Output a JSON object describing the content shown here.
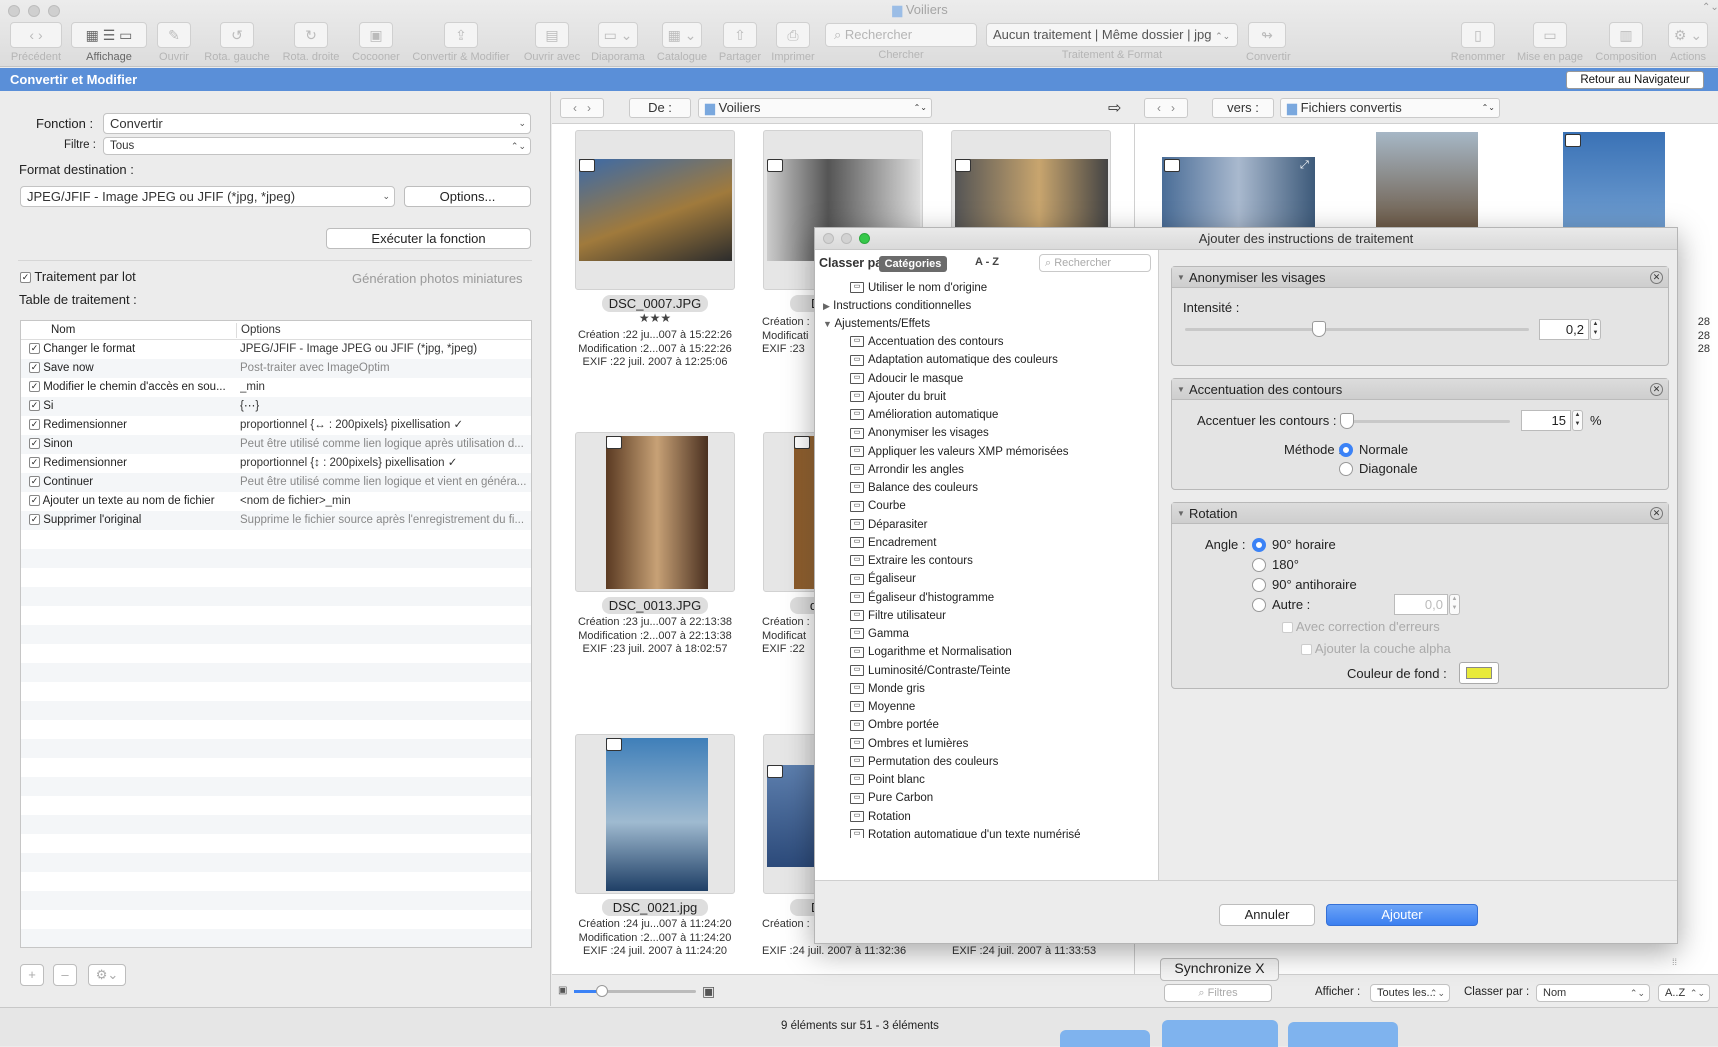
{
  "window": {
    "title": "Voiliers"
  },
  "toolbar": {
    "items": [
      "Précédent",
      "Affichage",
      "Ouvrir",
      "Rota. gauche",
      "Rota. droite",
      "Cocooner",
      "Convertir & Modifier",
      "Ouvrir avec",
      "Diaporama",
      "Catalogue",
      "Partager",
      "Imprimer"
    ],
    "search_placeholder": "Rechercher",
    "search_label": "Chercher",
    "treatment_value": "Aucun traitement | Même dossier | jpg",
    "treatment_label": "Traitement & Format",
    "convert_label": "Convertir",
    "right_items": [
      "Renommer",
      "Mise en page",
      "Composition",
      "Actions"
    ]
  },
  "convert_bar": {
    "title": "Convertir et Modifier",
    "back_button": "Retour au Navigateur"
  },
  "left": {
    "fonction_label": "Fonction :",
    "fonction_value": "Convertir",
    "filtre_label": "Filtre :",
    "filtre_value": "Tous",
    "format_label": "Format destination :",
    "format_value": "JPEG/JFIF - Image JPEG ou JFIF (*jpg, *jpeg)",
    "options_button": "Options...",
    "execute_button": "Exécuter la fonction",
    "batch_label": "Traitement par lot",
    "thumbs_link": "Génération photos miniatures",
    "table_label": "Table de traitement :",
    "table_headers": [
      "Nom",
      "Options"
    ],
    "rows": [
      {
        "name": "Changer le format",
        "options": "JPEG/JFIF - Image JPEG ou JFIF (*jpg, *jpeg)",
        "grey": false
      },
      {
        "name": "Save now",
        "options": "Post-traiter avec ImageOptim",
        "grey": true
      },
      {
        "name": "Modifier le chemin d'accès en sou...",
        "options": "_min",
        "grey": false
      },
      {
        "name": "Si",
        "options": "{⋯}",
        "grey": false
      },
      {
        "name": "Redimensionner",
        "options": "proportionnel {↔ : 200pixels}   pixellisation ✓",
        "grey": false
      },
      {
        "name": "Sinon",
        "options": "Peut être utilisé comme lien logique après utilisation d...",
        "grey": true
      },
      {
        "name": "Redimensionner",
        "options": "proportionnel {↕ : 200pixels}   pixellisation ✓",
        "grey": false
      },
      {
        "name": "Continuer",
        "options": "Peut être utilisé comme lien logique et vient en généra...",
        "grey": true
      },
      {
        "name": "Ajouter un texte au nom de fichier",
        "options": "<nom de fichier>_min",
        "grey": false
      },
      {
        "name": "Supprimer l'original",
        "options": "Supprime le fichier source après l'enregistrement du fi...",
        "grey": true
      }
    ]
  },
  "source_nav": {
    "de_label": "De :",
    "folder": "Voiliers"
  },
  "dest_nav": {
    "vers_label": "vers :",
    "folder": "Fichiers convertis"
  },
  "thumbs": [
    {
      "name": "DSC_0007.JPG",
      "stars": "★★★",
      "creation": "Création :22 ju...007 à 15:22:26",
      "modification": "Modification :2...007 à 15:22:26",
      "exif": "EXIF :22 juil. 2007 à 12:25:06"
    },
    {
      "name": "DSC_0013.JPG",
      "stars": "",
      "creation": "Création :23 ju...007 à 22:13:38",
      "modification": "Modification :2...007 à 22:13:38",
      "exif": "EXIF :23 juil. 2007 à 18:02:57"
    },
    {
      "name": "DSC_0021.jpg",
      "stars": "",
      "creation": "Création :24 ju...007 à 11:24:20",
      "modification": "Modification :2...007 à 11:24:20",
      "exif": "EXIF :24 juil. 2007 à 11:24:20"
    }
  ],
  "partial_thumbs": {
    "col2_name_1": "DS",
    "col2_creation_1": "Création :",
    "col2_modif_1": "Modificati",
    "col2_exif_1": "EXIF :23",
    "col2_name_2": "dsc",
    "col2_creation_2": "Création :",
    "col2_modif_2": "Modificat",
    "col2_exif_2": "EXIF :22",
    "col2_name_3": "DS",
    "col2_creation_3": "Création :",
    "col2_exif_3": "EXIF :24 juil. 2007 à 11:32:36",
    "col3_exif_3": "EXIF :24 juil. 2007 à 11:33:53",
    "right_edge_1": "28",
    "right_edge_2": "28",
    "right_edge_3": "28"
  },
  "dialog": {
    "title": "Ajouter des instructions de traitement",
    "sort_label": "Classer pa",
    "tab_categories": "Catégories",
    "tab_az": "A - Z",
    "search_placeholder": "Rechercher",
    "list_top": [
      "Utiliser le nom d'origine",
      "Instructions conditionnelles",
      "Ajustements/Effets"
    ],
    "effects": [
      "Accentuation des contours",
      "Adaptation automatique des couleurs",
      "Adoucir le masque",
      "Ajouter du bruit",
      "Amélioration automatique",
      "Anonymiser les visages",
      "Appliquer les valeurs XMP mémorisées",
      "Arrondir les angles",
      "Balance des couleurs",
      "Courbe",
      "Déparasiter",
      "Encadrement",
      "Extraire les contours",
      "Égaliseur",
      "Égaliseur d'histogramme",
      "Filtre utilisateur",
      "Gamma",
      "Logarithme et Normalisation",
      "Luminosité/Contraste/Teinte",
      "Monde gris",
      "Moyenne",
      "Ombre portée",
      "Ombres et lumières",
      "Permutation des couleurs",
      "Point blanc",
      "Pure Carbon",
      "Rotation",
      "Rotation automatique d'un texte numérisé"
    ],
    "box1": {
      "title": "Anonymiser les visages",
      "label": "Intensité :",
      "value": "0,2",
      "slider_fraction": 0.4
    },
    "box2": {
      "title": "Accentuation des contours",
      "label": "Accentuer les contours :",
      "value": "15",
      "unit": "%",
      "slider_fraction": 0.01,
      "method_label": "Méthode :",
      "methods": [
        "Normale",
        "Diagonale"
      ]
    },
    "box3": {
      "title": "Rotation",
      "angle_label": "Angle :",
      "options": [
        "90° horaire",
        "180°",
        "90° antihoraire",
        "Autre :"
      ],
      "other_value": "0,0",
      "check1": "Avec correction d'erreurs",
      "check2": "Ajouter la couche alpha",
      "bg_label": "Couleur de fond :",
      "bg_color": "#e8ea3a"
    },
    "cancel_button": "Annuler",
    "add_button": "Ajouter"
  },
  "bottom": {
    "sync_button": "Synchronize X",
    "filter_placeholder": "Filtres",
    "afficher_label": "Afficher :",
    "afficher_value": "Toutes les...",
    "classer_label": "Classer par :",
    "classer_value": "Nom",
    "order_value": "A..Z",
    "status": "9 éléments sur 51 - 3 éléments"
  }
}
